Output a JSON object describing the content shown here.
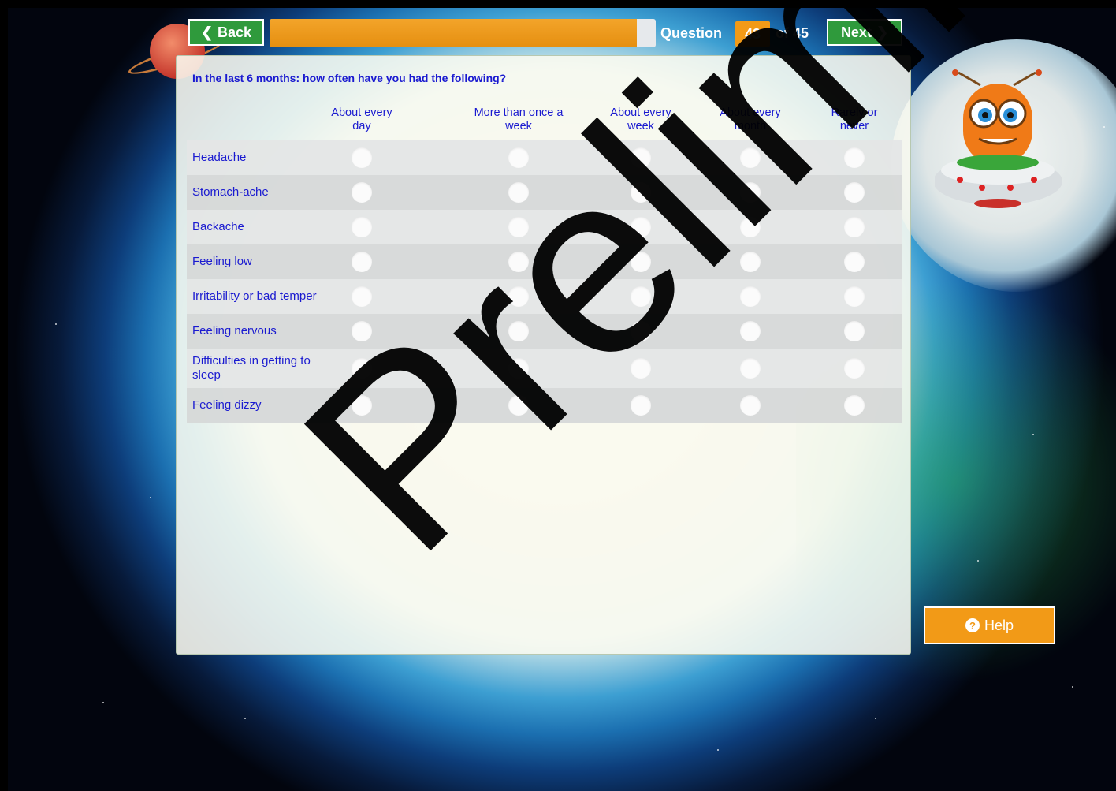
{
  "nav": {
    "back_label": "Back",
    "next_label": "Next",
    "question_label": "Question",
    "question_number": "43",
    "question_of": "of 45",
    "progress_percent": 95
  },
  "survey": {
    "question": "In the last 6 months: how often have you had the following?",
    "columns": [
      "About every day",
      "More than once a week",
      "About every week",
      "About every month",
      "Rarely or never"
    ],
    "rows": [
      "Headache",
      "Stomach-ache",
      "Backache",
      "Feeling low",
      "Irritability or bad temper",
      "Feeling nervous",
      "Difficulties in getting to sleep",
      "Feeling dizzy"
    ]
  },
  "help": {
    "label": "Help"
  },
  "watermark": "Preliminary",
  "colors": {
    "nav_green": "#2f9a3c",
    "accent_orange": "#f29a17",
    "text_blue": "#1a1ad0"
  }
}
